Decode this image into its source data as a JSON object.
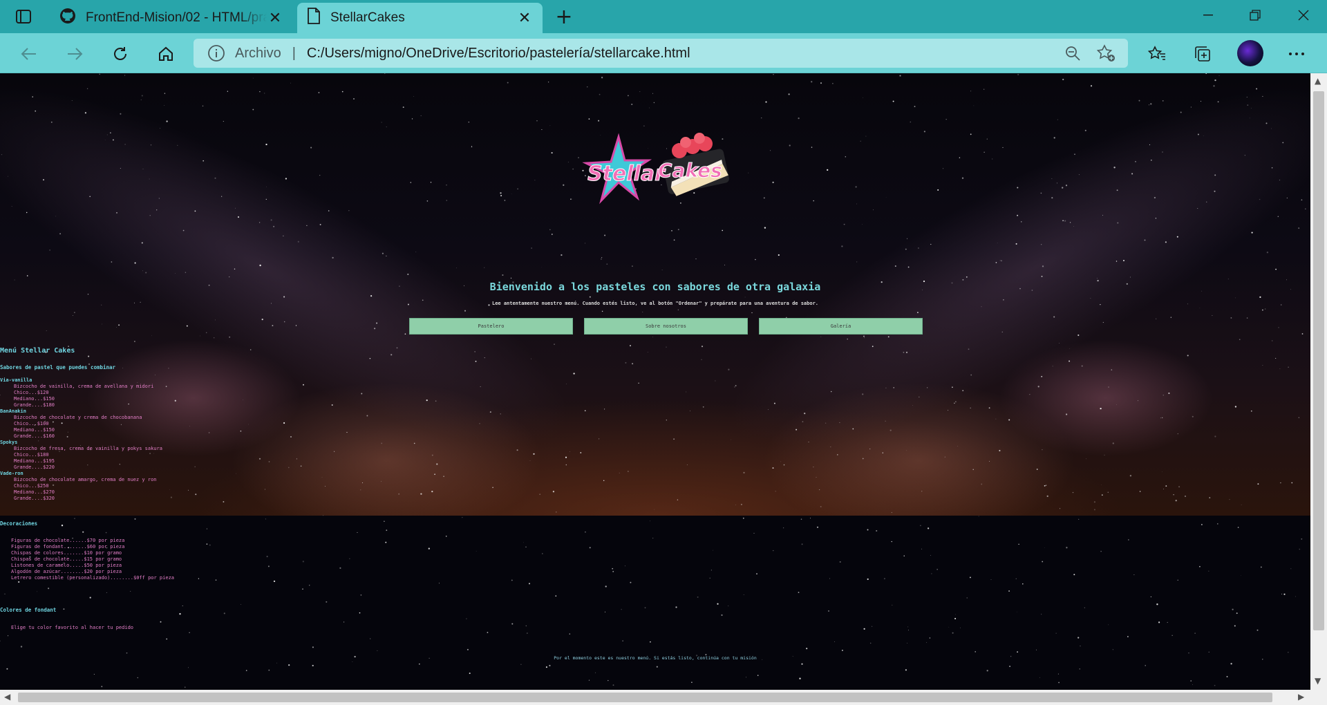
{
  "browser": {
    "tabs": [
      {
        "title": "FrontEnd-Mision/02 - HTML/práctica",
        "icon": "github-icon"
      },
      {
        "title": "StellarCakes",
        "icon": "document-icon"
      }
    ],
    "address": {
      "scheme_label": "Archivo",
      "url": "C:/Users/migno/OneDrive/Escritorio/pastelería/stellarcake.html"
    }
  },
  "page": {
    "logo_alt": "StellarCakes",
    "welcome_title": "Bienvenido a los pasteles con sabores de otra galaxia",
    "welcome_sub": "Lee antentamente nuestro menú. Cuando estés listo, ve al botón \"Ordenar\" y prepárate para una aventura de sabor.",
    "buttons": [
      "Pastelero",
      "Sobre nosotros",
      "Galería"
    ],
    "menu_title": "Menú Stellar Cakes",
    "flavors_title": "Sabores de pastel que puedes combinar",
    "cakes": [
      {
        "name": "Via-vanilla",
        "desc": "Bizcocho de vainilla, crema de avellana y midori",
        "sizes": [
          "Chico...$120",
          "Mediano...$150",
          "Grande....$180"
        ]
      },
      {
        "name": "BanAnakin",
        "desc": "Bizcocho de chocolate y crema de chocobanana",
        "sizes": [
          "Chico...$100",
          "Mediano...$150",
          "Grande....$160"
        ]
      },
      {
        "name": "Spokys",
        "desc": "Bizcocho de fresa, crema de vainilla y pokys sakura",
        "sizes": [
          "Chico...$180",
          "Mediano...$195",
          "Grande....$220"
        ]
      },
      {
        "name": "Vade-ron",
        "desc": "Bizcocho de chocolate amargo, crema de nuez y ron",
        "sizes": [
          "Chico...$250",
          "Mediano...$270",
          "Grande....$320"
        ]
      }
    ],
    "decor_title": "Decoraciones",
    "decorations": [
      "Figuras de chocolate......$70 por pieza",
      "Figuras de fondant........$60 por pieza",
      "Chispas de colores.......$10 por gramo",
      "Chispas de chocolate.....$15 por gramo",
      "Listones de caramelo.....$50 por pieza",
      "Algodón de azúcar........$20 por pieza",
      "Letrero comestible (personalizado)........$0ff por pieza"
    ],
    "fondant_title": "Colores de fondant",
    "fondant_text": "Elige tu color favorito al hacer tu pedido",
    "footer_note": "Por el momento este es nuestro menú. Si estás listo, continúa con tu misión"
  }
}
